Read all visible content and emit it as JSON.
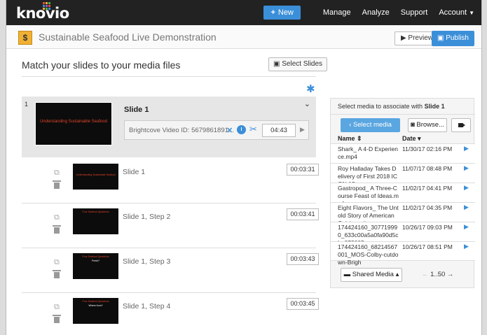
{
  "nav": {
    "logo": "knovio",
    "new_label": "New",
    "links": [
      "Manage",
      "Analyze",
      "Support",
      "Account"
    ],
    "colors": {
      "accent": "#3b8fd9",
      "nav_bg": "#222222"
    }
  },
  "titlebar": {
    "presentation_title": "Sustainable Seafood Live Demonstration",
    "preview_label": "Preview",
    "publish_label": "Publish"
  },
  "main": {
    "heading": "Match your slides to your media files",
    "select_slides_label": "Select Slides",
    "selected_slide": {
      "number": "1",
      "title": "Slide 1",
      "thumb_text": "Understanding Sustainable Seafood",
      "media_label": "Brightcove Video ID: 5679861891...",
      "time": "04:43"
    },
    "steps": [
      {
        "title": "Slide 1",
        "time": "00:03:31",
        "thumb_t1": "Understanding Sustainable Seafood",
        "thumb_t2": ""
      },
      {
        "title": "Slide 1, Step 2",
        "time": "00:03:41",
        "thumb_t1": "Four Seafood Questions",
        "thumb_t2": ""
      },
      {
        "title": "Slide 1, Step 3",
        "time": "00:03:43",
        "thumb_t1": "Four Seafood Questions",
        "thumb_t2": "Fresh?"
      },
      {
        "title": "Slide 1, Step 4",
        "time": "00:03:45",
        "thumb_t1": "Four Seafood Questions",
        "thumb_t2": "Where from?"
      }
    ]
  },
  "media_panel": {
    "header_prefix": "Select media to associate with",
    "header_target": "Slide 1",
    "select_media_label": "Select media",
    "browse_label": "Browse...",
    "col_name": "Name",
    "col_date": "Date",
    "rows": [
      {
        "name": "Shark_ A 4-D Experience.mp4",
        "date": "11/30/17 02:16 PM"
      },
      {
        "name": "Roy Halladay Takes Delivery of First 2018 ICON A5.mp",
        "date": "11/07/17 08:48 PM"
      },
      {
        "name": "Gastropod_ A Three-Course Feast of Ideas.mp4",
        "date": "11/02/17 04:41 PM"
      },
      {
        "name": "Eight Flavors_ The Untold Story of American Cuisine wit",
        "date": "11/02/17 04:35 PM"
      },
      {
        "name": "174424160_307719990_633c00a5a0fa90d5cbe073805",
        "date": "10/26/17 09:03 PM"
      },
      {
        "name": "174424160_68214567001_MOS-Colby-cutdown-Brigh",
        "date": "10/26/17 08:51 PM"
      }
    ],
    "shared_media_label": "Shared Media",
    "pager": "1..50"
  }
}
